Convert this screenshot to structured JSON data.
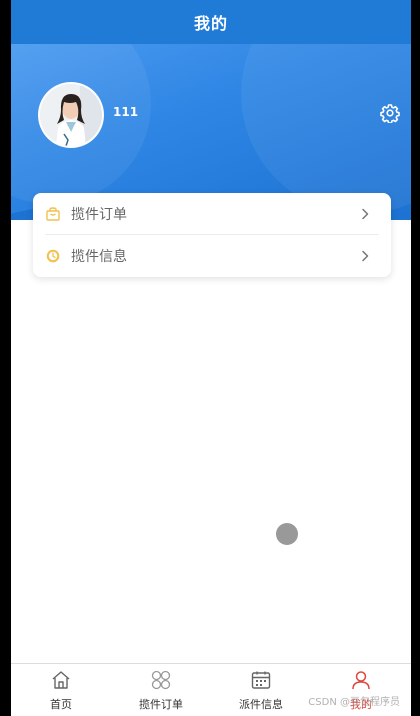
{
  "header": {
    "title": "我的"
  },
  "profile": {
    "username": "111"
  },
  "menu": {
    "items": [
      {
        "label": "揽件订单",
        "icon": "bag-icon"
      },
      {
        "label": "揽件信息",
        "icon": "clock-icon"
      }
    ]
  },
  "tabbar": {
    "items": [
      {
        "label": "首页",
        "icon": "home-icon"
      },
      {
        "label": "揽件订单",
        "icon": "grid-icon"
      },
      {
        "label": "派件信息",
        "icon": "calendar-icon"
      },
      {
        "label": "我的",
        "icon": "user-icon",
        "active": true
      }
    ]
  },
  "watermark": "CSDN @豆包程序员",
  "colors": {
    "primary": "#1f7bd6",
    "active_tab": "#e0463e",
    "menu_icon": "#f2c14e"
  }
}
